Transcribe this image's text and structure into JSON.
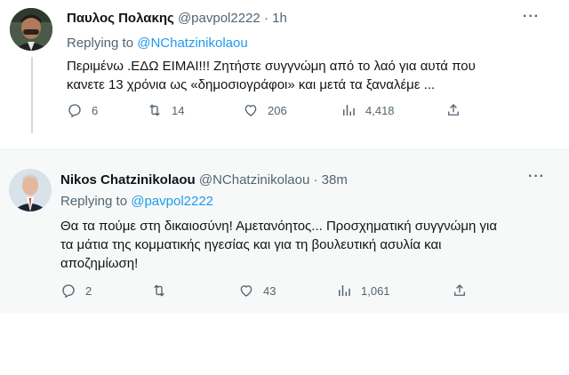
{
  "tweet1": {
    "name": "Παυλος Πολακης",
    "handle": "@pavpol2222",
    "time": "1h",
    "replying_prefix": "Replying to",
    "replying_to": "@NChatzinikolaou",
    "text_line1": "Περιμένω .ΕΔΩ ΕΙΜΑΙ!!! Ζητήστε συγγνώμη από το λαό για αυτά που",
    "text_line2": "κανετε 13 χρόνια ως «δημοσιογράφοι» και μετά τα ξαναλέμε ...",
    "replies": "6",
    "retweets": "14",
    "likes": "206",
    "views": "4,418"
  },
  "tweet2": {
    "name": "Nikos Chatzinikolaou",
    "handle": "@NChatzinikolaou",
    "time": "38m",
    "replying_prefix": "Replying to",
    "replying_to": "@pavpol2222",
    "text_line1": "Θα τα πούμε στη δικαιοσύνη! Αμετανόητος... Προσχηματική συγγνώμη για",
    "text_line2": "τα μάτια της κομματικής ηγεσίας και για τη βουλευτική ασυλία και",
    "text_line3": "αποζημίωση!",
    "replies": "2",
    "likes": "43",
    "views": "1,061"
  },
  "icons": {
    "reply": "reply-icon",
    "retweet": "retweet-icon",
    "like": "like-icon",
    "views": "views-icon",
    "share": "share-icon",
    "more": "more-icon"
  },
  "colors": {
    "link": "#1d9bf0",
    "muted": "#536471",
    "text": "#0f1419"
  },
  "separator": "·",
  "more_glyph": "···"
}
